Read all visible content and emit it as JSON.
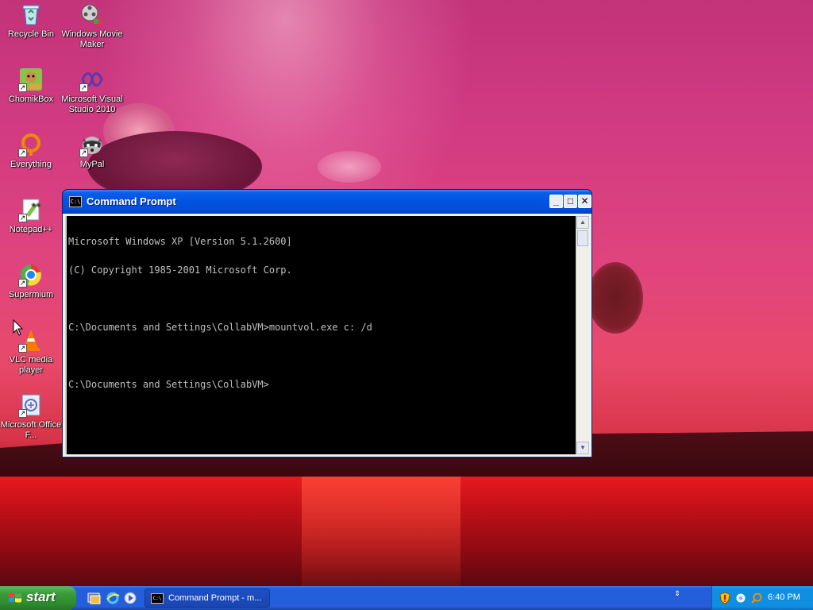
{
  "desktop": {
    "icons": [
      {
        "label": "Recycle Bin"
      },
      {
        "label": "Windows Movie Maker"
      },
      {
        "label": "ChomikBox"
      },
      {
        "label": "Microsoft Visual Studio 2010"
      },
      {
        "label": "Everything"
      },
      {
        "label": "MyPal"
      },
      {
        "label": "Notepad++"
      },
      {
        "label": "Supermium"
      },
      {
        "label": "VLC media player"
      },
      {
        "label": "Microsoft Office F..."
      }
    ]
  },
  "window": {
    "title": "Command Prompt",
    "icon_text": "C:\\",
    "console_lines": [
      "Microsoft Windows XP [Version 5.1.2600]",
      "(C) Copyright 1985-2001 Microsoft Corp.",
      "",
      "C:\\Documents and Settings\\CollabVM>mountvol.exe c: /d",
      "",
      "C:\\Documents and Settings\\CollabVM>"
    ],
    "buttons": {
      "minimize": "_",
      "maximize": "□",
      "close": "✕"
    }
  },
  "taskbar": {
    "start_label": "start",
    "task_button_label": "Command Prompt - m...",
    "clock": "6:40 PM"
  },
  "colors": {
    "titlebar": "#0054e3",
    "taskbar": "#245edb",
    "start_button": "#3c9c3c",
    "tray": "#0f8ee2",
    "console_bg": "#000000",
    "console_fg": "#c0c0c0"
  }
}
